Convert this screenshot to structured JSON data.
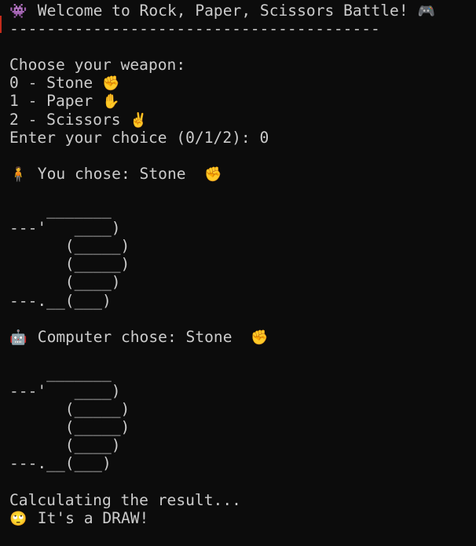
{
  "terminal": {
    "lines": [
      {
        "icon": "👾",
        "icon_name": "alien-monster-icon",
        "text": " Welcome to Rock, Paper, Scissors Battle! ",
        "trail_icon": "🎮",
        "trail_icon_name": "game-controller-icon"
      },
      {
        "text": "----------------------------------------"
      },
      {
        "text": ""
      },
      {
        "text": "Choose your weapon:"
      },
      {
        "text": "0 - Stone ",
        "trail_icon": "✊",
        "trail_icon_name": "raised-fist-icon"
      },
      {
        "text": "1 - Paper ",
        "trail_icon": "✋",
        "trail_icon_name": "raised-hand-icon"
      },
      {
        "text": "2 - Scissors ",
        "trail_icon": "✌️",
        "trail_icon_name": "victory-hand-icon"
      },
      {
        "text": "Enter your choice (0/1/2): 0"
      },
      {
        "text": ""
      },
      {
        "icon": "🧍",
        "icon_name": "person-standing-icon",
        "text": " You chose: Stone  ",
        "trail_icon": "✊",
        "trail_icon_name": "raised-fist-icon"
      },
      {
        "text": ""
      },
      {
        "text": "    _______"
      },
      {
        "text": "---'   ____)"
      },
      {
        "text": "      (_____)"
      },
      {
        "text": "      (_____)"
      },
      {
        "text": "      (____)"
      },
      {
        "text": "---.__(___)"
      },
      {
        "text": ""
      },
      {
        "icon": "🤖",
        "icon_name": "robot-icon",
        "text": " Computer chose: Stone  ",
        "trail_icon": "✊",
        "trail_icon_name": "raised-fist-icon"
      },
      {
        "text": ""
      },
      {
        "text": "    _______"
      },
      {
        "text": "---'   ____)"
      },
      {
        "text": "      (_____)"
      },
      {
        "text": "      (_____)"
      },
      {
        "text": "      (____)"
      },
      {
        "text": "---.__(___)"
      },
      {
        "text": ""
      },
      {
        "text": "Calculating the result..."
      },
      {
        "icon": "🙄",
        "icon_name": "face-rolling-eyes-icon",
        "text": " It's a DRAW!"
      }
    ]
  },
  "colors": {
    "background": "#0c0c0c",
    "foreground": "#cccccc",
    "accent": "#c42b1c"
  }
}
